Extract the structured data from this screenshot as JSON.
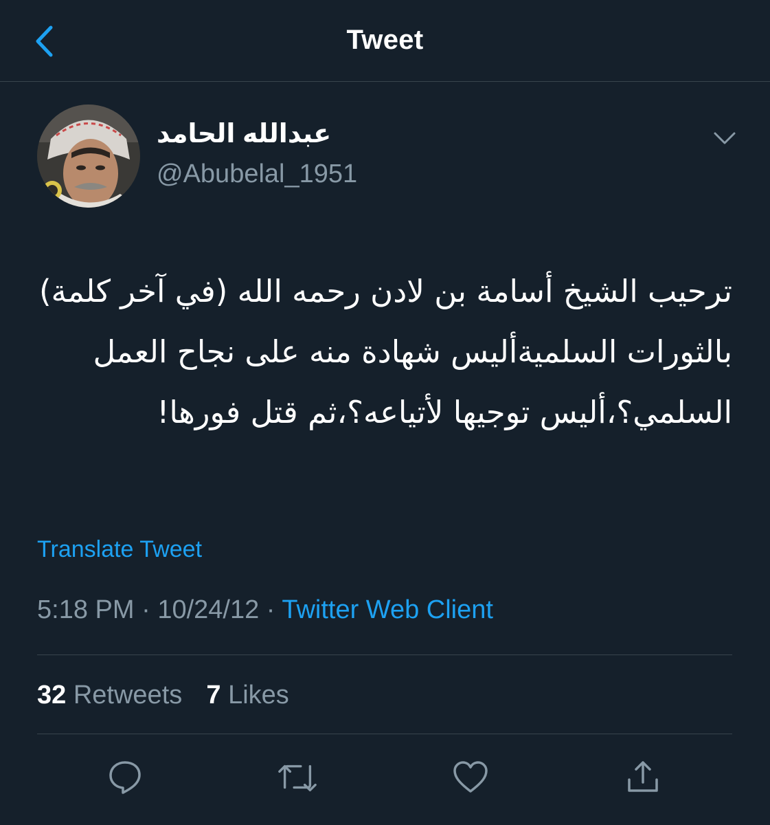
{
  "header": {
    "title": "Tweet",
    "back_icon": "chevron-left-icon"
  },
  "author": {
    "display_name": "عبدالله الحامد",
    "handle": "@Abubelal_1951",
    "menu_icon": "chevron-down-icon"
  },
  "tweet": {
    "text": "ترحيب الشيخ أسامة بن لادن رحمه الله (في آخر كلمة) بالثورات السلميةأليس شهادة منه على نجاح العمل السلمي؟،أليس توجيها لأتياعه؟،ثم قتل فورها!",
    "translate_label": "Translate Tweet",
    "time": "5:18 PM",
    "separator": "·",
    "date": "10/24/12",
    "source": "Twitter Web Client"
  },
  "stats": {
    "retweets_count": "32",
    "retweets_label": "Retweets",
    "likes_count": "7",
    "likes_label": "Likes"
  },
  "actions": [
    {
      "icon": "reply-icon"
    },
    {
      "icon": "retweet-icon"
    },
    {
      "icon": "like-heart-icon"
    },
    {
      "icon": "share-icon"
    }
  ],
  "colors": {
    "background": "#15202b",
    "accent": "#1da1f2",
    "secondary_text": "#8899a6",
    "divider": "#38444d"
  }
}
